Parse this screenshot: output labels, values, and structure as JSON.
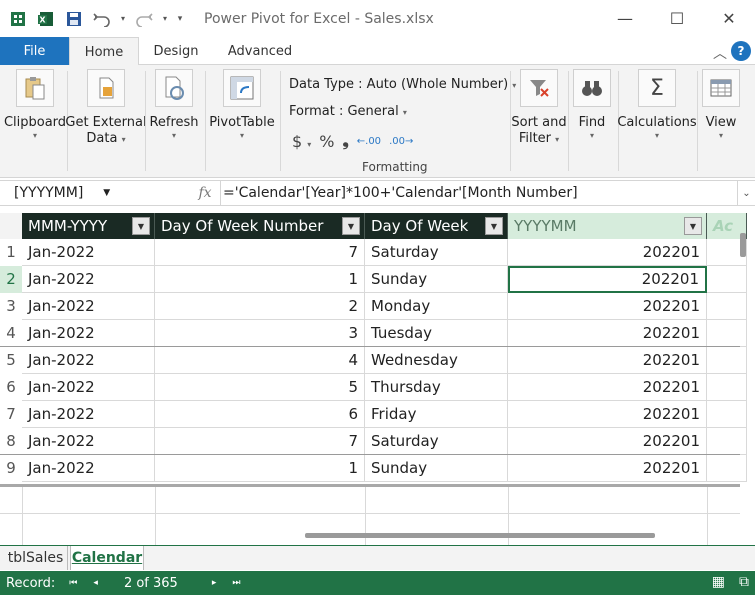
{
  "window": {
    "title": "Power Pivot for Excel - Sales.xlsx"
  },
  "tabs": {
    "file": "File",
    "home": "Home",
    "design": "Design",
    "advanced": "Advanced"
  },
  "help_label": "?",
  "ribbon": {
    "clipboard": "Clipboard",
    "get_external_data": "Get External",
    "get_external_data_2": "Data",
    "refresh": "Refresh",
    "pivottable": "PivotTable",
    "data_type": "Data Type : Auto (Whole Number)",
    "format": "Format : General",
    "formatting_group": "Formatting",
    "sort_and_filter": "Sort and",
    "sort_and_filter_2": "Filter",
    "find": "Find",
    "calculations": "Calculations",
    "view": "View"
  },
  "formula_bar": {
    "name_box": "[YYYYMM]",
    "formula": "='Calendar'[Year]*100+'Calendar'[Month Number]"
  },
  "table": {
    "columns": [
      "MMM-YYYY",
      "Day Of Week Number",
      "Day Of Week",
      "YYYYMM",
      "Ac"
    ],
    "row_numbers": [
      "1",
      "2",
      "3",
      "4",
      "5",
      "6",
      "7",
      "8",
      "9"
    ],
    "rows": [
      [
        "Jan-2022",
        "7",
        "Saturday",
        "202201"
      ],
      [
        "Jan-2022",
        "1",
        "Sunday",
        "202201"
      ],
      [
        "Jan-2022",
        "2",
        "Monday",
        "202201"
      ],
      [
        "Jan-2022",
        "3",
        "Tuesday",
        "202201"
      ],
      [
        "Jan-2022",
        "4",
        "Wednesday",
        "202201"
      ],
      [
        "Jan-2022",
        "5",
        "Thursday",
        "202201"
      ],
      [
        "Jan-2022",
        "6",
        "Friday",
        "202201"
      ],
      [
        "Jan-2022",
        "7",
        "Saturday",
        "202201"
      ],
      [
        "Jan-2022",
        "1",
        "Sunday",
        "202201"
      ]
    ]
  },
  "sheets": {
    "tblSales": "tblSales",
    "calendar": "Calendar"
  },
  "status": {
    "record_label": "Record:",
    "record_count": "2 of 365"
  },
  "colors": {
    "accent": "#217346",
    "file_tab": "#1e73be",
    "header_bg": "#1a2a24"
  }
}
